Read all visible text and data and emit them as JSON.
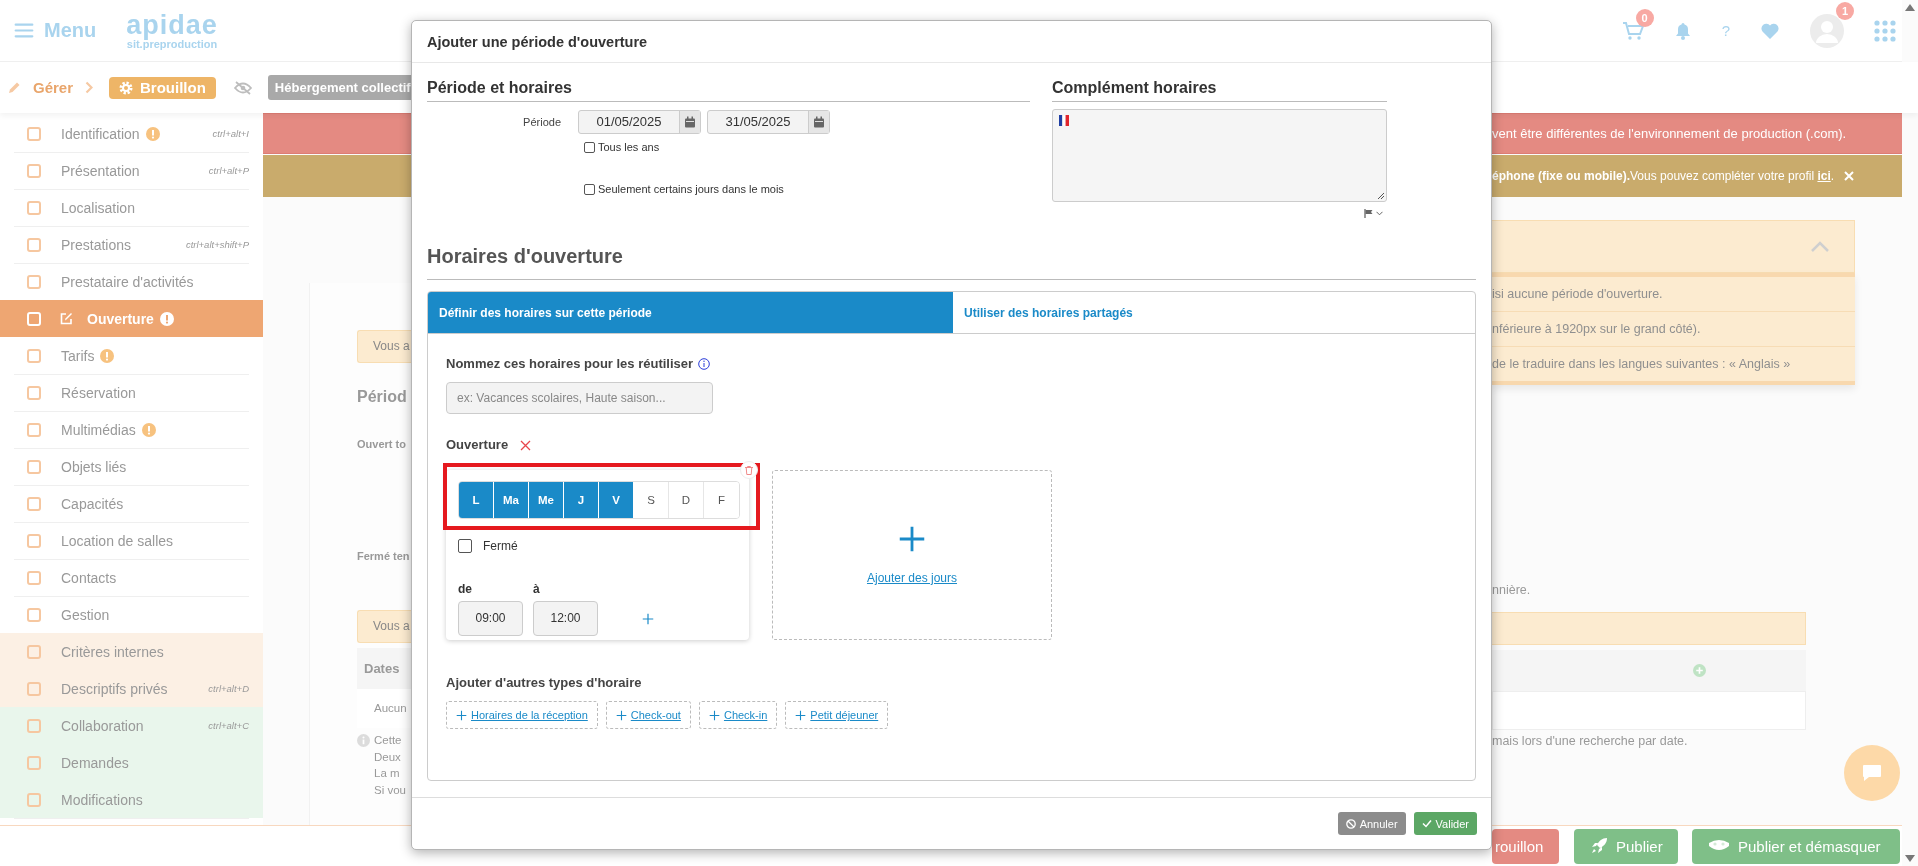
{
  "header": {
    "menu_label": "Menu",
    "logo": "apidae",
    "logo_subtitle": "sit.preproduction",
    "cart_count": "0",
    "help_label": "?",
    "avatar_count": "1"
  },
  "toolbar": {
    "manage_label": "Gérer",
    "status": "Brouillon",
    "category": "Hébergement collectif"
  },
  "sidebar": {
    "items": [
      {
        "label": "Identification",
        "shortcut": "ctrl+alt+I",
        "warning": true,
        "selected": false,
        "private": false,
        "shared": false
      },
      {
        "label": "Présentation",
        "shortcut": "ctrl+alt+P",
        "warning": false,
        "selected": false,
        "private": false,
        "shared": false
      },
      {
        "label": "Localisation",
        "warning": false,
        "selected": false,
        "private": false,
        "shared": false
      },
      {
        "label": "Prestations",
        "shortcut": "ctrl+alt+shift+P",
        "warning": false,
        "selected": false,
        "private": false,
        "shared": false
      },
      {
        "label": "Prestataire d'activités",
        "warning": false,
        "selected": false,
        "private": false,
        "shared": false
      },
      {
        "label": "Ouverture",
        "warning": true,
        "selected": true,
        "private": false,
        "shared": false
      },
      {
        "label": "Tarifs",
        "warning": true,
        "selected": false,
        "private": false,
        "shared": false
      },
      {
        "label": "Réservation",
        "warning": false,
        "selected": false,
        "private": false,
        "shared": false
      },
      {
        "label": "Multimédias",
        "warning": true,
        "selected": false,
        "private": false,
        "shared": false
      },
      {
        "label": "Objets liés",
        "warning": false,
        "selected": false,
        "private": false,
        "shared": false
      },
      {
        "label": "Capacités",
        "warning": false,
        "selected": false,
        "private": false,
        "shared": false
      },
      {
        "label": "Location de salles",
        "warning": false,
        "selected": false,
        "private": false,
        "shared": false
      },
      {
        "label": "Contacts",
        "warning": false,
        "selected": false,
        "private": false,
        "shared": false
      },
      {
        "label": "Gestion",
        "warning": false,
        "selected": false,
        "private": false,
        "shared": false
      },
      {
        "label": "Critères internes",
        "warning": false,
        "selected": false,
        "private": true,
        "shared": false
      },
      {
        "label": "Descriptifs privés",
        "shortcut": "ctrl+alt+D",
        "warning": false,
        "selected": false,
        "private": true,
        "shared": false
      },
      {
        "label": "Collaboration",
        "shortcut": "ctrl+alt+C",
        "warning": false,
        "selected": false,
        "private": false,
        "shared": true
      },
      {
        "label": "Demandes",
        "warning": false,
        "selected": false,
        "private": false,
        "shared": true
      },
      {
        "label": "Modifications",
        "warning": false,
        "selected": false,
        "private": false,
        "shared": true
      }
    ]
  },
  "banners": {
    "error": "vent être différentes de l'environnement de production (.com).",
    "notice": "**éphone (fixe ou mobile).**Vous pouvez compléter votre profil ",
    "notice_link": "ici",
    "notice_end": "."
  },
  "page_left": {
    "alert_1": "Vous a",
    "heading": "Périod",
    "label_open": "Ouvert to",
    "label_closed": "Fermé ten",
    "alert_2": "Vous a",
    "table_header": "Dates",
    "table_cell": "Aucun",
    "info_lines": [
      "Cette",
      "Deux",
      "La m",
      "Si vou"
    ]
  },
  "page_right": {
    "summary_items": [
      "isi aucune période d'ouverture.",
      "nférieure à 1920px sur le grand côté).",
      "de le traduire dans les langues suivantes : « Anglais »"
    ],
    "note": "nnière.",
    "footnote": "mais lors d'une recherche par date."
  },
  "modal": {
    "title": "Ajouter une période d'ouverture",
    "period": {
      "heading": "Période et horaires",
      "label": "Période",
      "start": "01/05/2025",
      "end": "31/05/2025",
      "options": [
        {
          "label": "Tous les ans",
          "checked": false
        },
        {
          "label": "Seulement certains jours dans le mois",
          "checked": false
        }
      ]
    },
    "complement": {
      "heading": "Complément horaires"
    },
    "hours": {
      "heading": "Horaires d'ouverture",
      "tabs": [
        {
          "label": "Définir des horaires sur cette période",
          "selected": true
        },
        {
          "label": "Utiliser des horaires partagés",
          "selected": false
        }
      ],
      "name_field": {
        "label": "Nommez ces horaires pour les réutiliser",
        "placeholder": "ex: Vacances scolaires, Haute saison..."
      },
      "opening": {
        "label": "Ouverture",
        "days": [
          {
            "label": "L",
            "selected": true
          },
          {
            "label": "Ma",
            "selected": true
          },
          {
            "label": "Me",
            "selected": true
          },
          {
            "label": "J",
            "selected": true
          },
          {
            "label": "V",
            "selected": true
          },
          {
            "label": "S",
            "selected": false
          },
          {
            "label": "D",
            "selected": false
          },
          {
            "label": "F",
            "selected": false
          }
        ],
        "closed": {
          "label": "Fermé",
          "checked": false
        },
        "from_label": "de",
        "to_label": "à",
        "from": "09:00",
        "to": "12:00"
      },
      "add_days": "Ajouter des jours",
      "other_types": {
        "label": "Ajouter d'autres types d'horaire",
        "buttons": [
          "Horaires de la réception",
          "Check-out",
          "Check-in",
          "Petit déjeuner"
        ]
      }
    },
    "buttons": [
      {
        "label": "Annuler",
        "kind": "cancel"
      },
      {
        "label": "Valider",
        "kind": "confirm"
      }
    ]
  },
  "bottom_bar": {
    "buttons": [
      {
        "label": "rouillon",
        "kind": "draft"
      },
      {
        "label": "Publier",
        "kind": "publish"
      },
      {
        "label": "Publier et démasquer",
        "kind": "unmask"
      }
    ]
  }
}
